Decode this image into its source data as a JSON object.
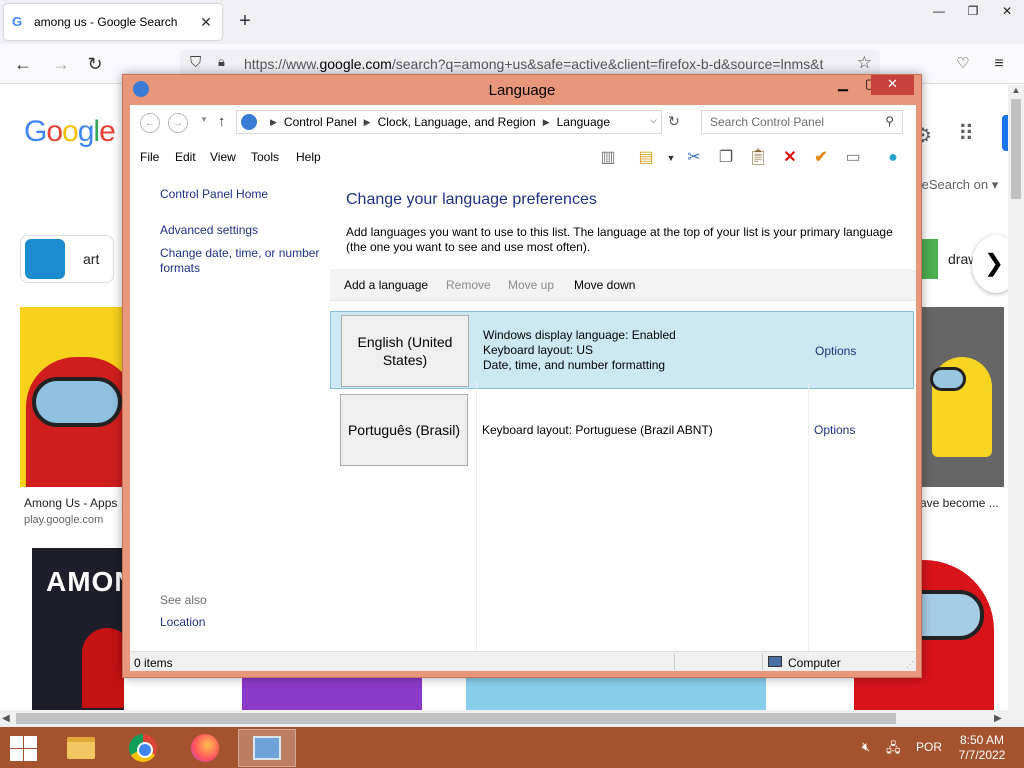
{
  "browser": {
    "tab_title": "among us - Google Search",
    "tab_close": "✕",
    "new_tab": "+",
    "url_prefix": "https://www.",
    "url_host": "google.com",
    "url_rest": "/search?q=among+us&safe=active&client=firefox-b-d&source=lnms&tbm",
    "window_min": "—",
    "window_max": "❐",
    "window_close": "✕"
  },
  "google": {
    "logo": [
      "G",
      "o",
      "o",
      "g",
      "l",
      "e"
    ],
    "chip_left_label": "art",
    "chip_right_label": "draw",
    "safesearch": "feSearch on ▾",
    "result_left_title": "Among Us - Apps ...",
    "result_left_source": "play.google.com",
    "result_right_title": "ave become ...",
    "img3_text": "AMON"
  },
  "dialog": {
    "title": "Language",
    "breadcrumb": [
      "Control Panel",
      "Clock, Language, and Region",
      "Language"
    ],
    "search_placeholder": "Search Control Panel",
    "menu": [
      "File",
      "Edit",
      "View",
      "Tools",
      "Help"
    ],
    "left_links": [
      "Control Panel Home",
      "Advanced settings",
      "Change date, time, or number formats"
    ],
    "see_also_label": "See also",
    "see_also_links": [
      "Location"
    ],
    "heading": "Change your language preferences",
    "description": "Add languages you want to use to this list. The language at the top of your list is your primary language (the one you want to see and use most often).",
    "actions": [
      {
        "label": "Add a language",
        "enabled": true
      },
      {
        "label": "Remove",
        "enabled": false
      },
      {
        "label": "Move up",
        "enabled": false
      },
      {
        "label": "Move down",
        "enabled": true
      }
    ],
    "languages": [
      {
        "name": "English (United States)",
        "details": [
          "Windows display language: Enabled",
          "Keyboard layout: US",
          "Date, time, and number formatting"
        ],
        "options_label": "Options",
        "selected": true
      },
      {
        "name": "Português (Brasil)",
        "details": [
          "Keyboard layout: Portuguese (Brazil ABNT)"
        ],
        "options_label": "Options",
        "selected": false
      }
    ],
    "status_items": "0 items",
    "status_location": "Computer"
  },
  "taskbar": {
    "language": "POR",
    "time": "8:50 AM",
    "date": "7/7/2022",
    "apps": [
      "file-explorer",
      "chrome",
      "firefox",
      "control-panel"
    ],
    "active_app": "control-panel"
  },
  "colors": {
    "dialog_frame": "#e9977a",
    "close_button": "#c7413d",
    "link": "#1e3287",
    "selected_row": "#cce8f3",
    "taskbar": "#a5532e"
  }
}
